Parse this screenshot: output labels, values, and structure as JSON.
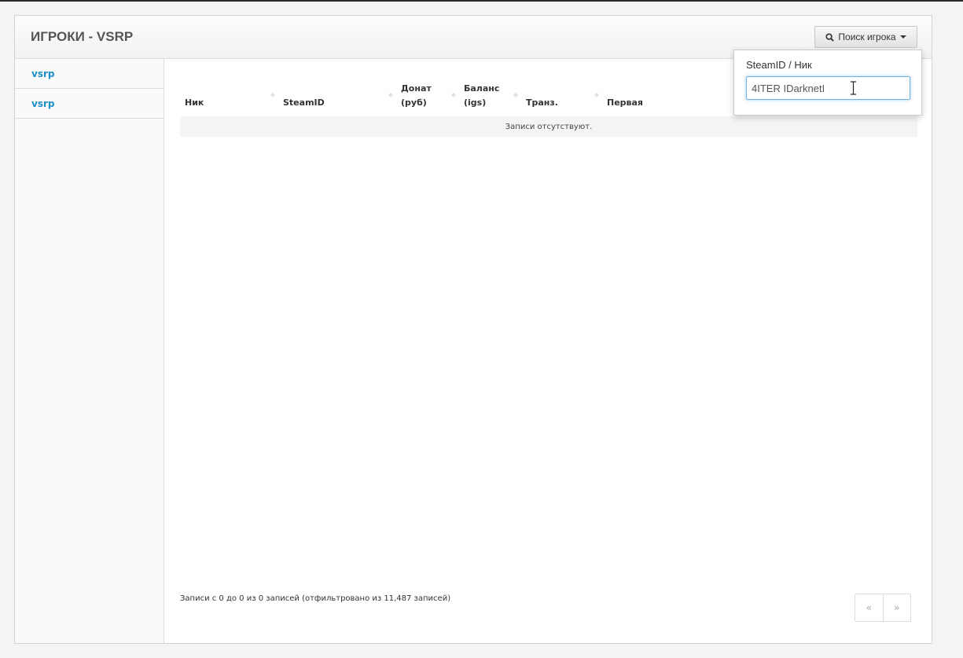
{
  "panel": {
    "title": "ИГРОКИ - VSRP",
    "search_button_label": "Поиск игрока"
  },
  "sidebar": {
    "items": [
      {
        "label": "vsrp"
      },
      {
        "label": "vsrp"
      }
    ]
  },
  "table": {
    "columns": [
      {
        "label": "Ник"
      },
      {
        "label": "SteamID"
      },
      {
        "label": "Донат (руб)"
      },
      {
        "label": "Баланс (igs)"
      },
      {
        "label": "Транз."
      },
      {
        "label": "Первая"
      }
    ],
    "empty_text": "Записи отсутствуют."
  },
  "footer": {
    "info": "Записи с 0 до 0 из 0 записей (отфильтровано из 11,487 записей)",
    "prev": "«",
    "next": "»"
  },
  "search_popover": {
    "label": "SteamID / Ник",
    "value": "4ITER IDarknetI"
  },
  "colors": {
    "link": "#1e8ec6",
    "input_focus": "#6fb3e0"
  }
}
